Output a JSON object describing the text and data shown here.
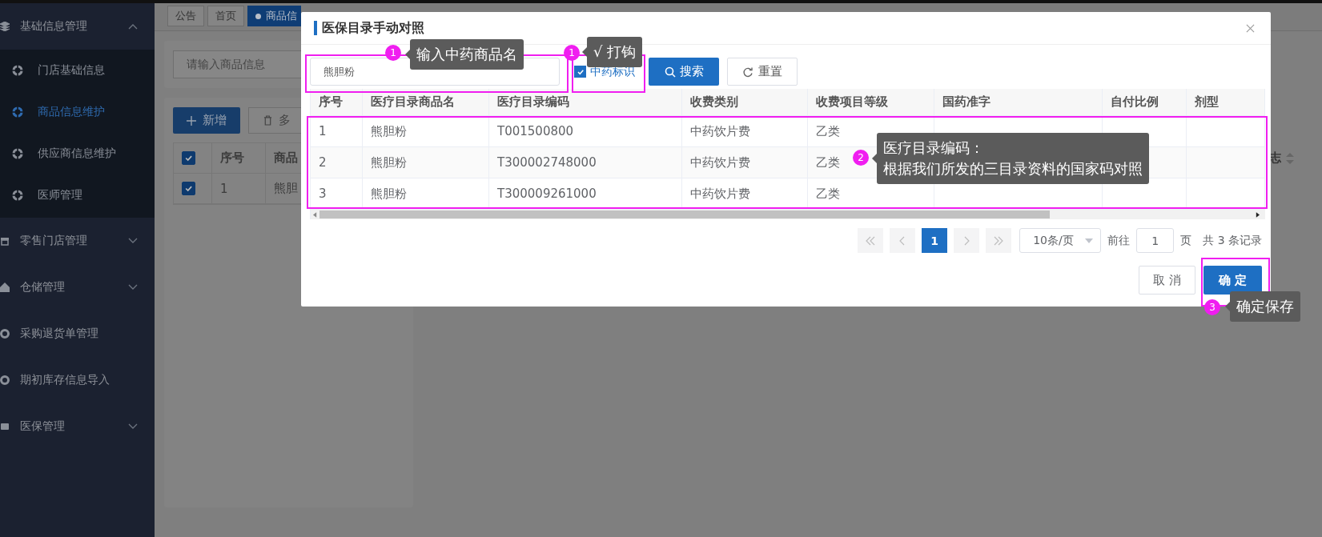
{
  "sidebar": {
    "groups": [
      {
        "label": "基础信息管理",
        "kind": "folder",
        "expanded": true,
        "children": [
          {
            "label": "门店基础信息",
            "selected": false
          },
          {
            "label": "商品信息维护",
            "selected": true
          },
          {
            "label": "供应商信息维护",
            "selected": false
          },
          {
            "label": "医师管理",
            "selected": false
          }
        ]
      },
      {
        "label": "零售门店管理",
        "kind": "folder",
        "expanded": false
      },
      {
        "label": "仓储管理",
        "kind": "folder",
        "expanded": false
      },
      {
        "label": "采购退货单管理",
        "kind": "link"
      },
      {
        "label": "期初库存信息导入",
        "kind": "link"
      },
      {
        "label": "医保管理",
        "kind": "folder",
        "expanded": false
      }
    ]
  },
  "tabs": [
    {
      "label": "公告",
      "selected": false
    },
    {
      "label": "首页",
      "selected": false
    },
    {
      "label": "商品信",
      "selected": true
    }
  ],
  "page": {
    "search": {
      "placeholder": "请输入商品信息"
    },
    "add_button": "新增",
    "delete_button": "多",
    "table": {
      "header_checked": true,
      "columns": [
        "序号",
        "商品"
      ],
      "rows": [
        {
          "checked": true,
          "cells": [
            "1",
            "熊胆"
          ]
        }
      ]
    },
    "far_column": "志"
  },
  "dialog": {
    "title": "医保目录手动对照",
    "search": {
      "value": "熊胆粉"
    },
    "herbal_filter": {
      "label": "中药标识",
      "checked": true
    },
    "search_button": "搜索",
    "reset_button": "重置",
    "table": {
      "columns": [
        "序号",
        "医疗目录商品名",
        "医疗目录编码",
        "收费类别",
        "收费项目等级",
        "国药准字",
        "自付比例",
        "剂型"
      ],
      "rows": [
        {
          "cells": [
            "1",
            "熊胆粉",
            "T001500800",
            "中药饮片费",
            "乙类"
          ]
        },
        {
          "cells": [
            "2",
            "熊胆粉",
            "T300002748000",
            "中药饮片费",
            "乙类"
          ]
        },
        {
          "cells": [
            "3",
            "熊胆粉",
            "T300009261000",
            "中药饮片费",
            "乙类"
          ]
        }
      ]
    },
    "pagination": {
      "pages": [
        {
          "label": "1",
          "selected": true
        }
      ],
      "page_size": "10条/页",
      "goto_label": "前往",
      "goto_value": "1",
      "page_unit": "页",
      "total": "共 3 条记录"
    },
    "cancel_button": "取 消",
    "confirm_button": "确 定"
  },
  "annotations": [
    {
      "badge": "1",
      "lines": [
        "输入中药商品名"
      ]
    },
    {
      "badge": "1",
      "lines": [
        "√ 打钩"
      ]
    },
    {
      "badge": "2",
      "lines": [
        "医疗目录编码：",
        "根据我们所发的三目录资料的国家码对照"
      ]
    },
    {
      "badge": "3",
      "lines": [
        "确定保存"
      ]
    }
  ]
}
